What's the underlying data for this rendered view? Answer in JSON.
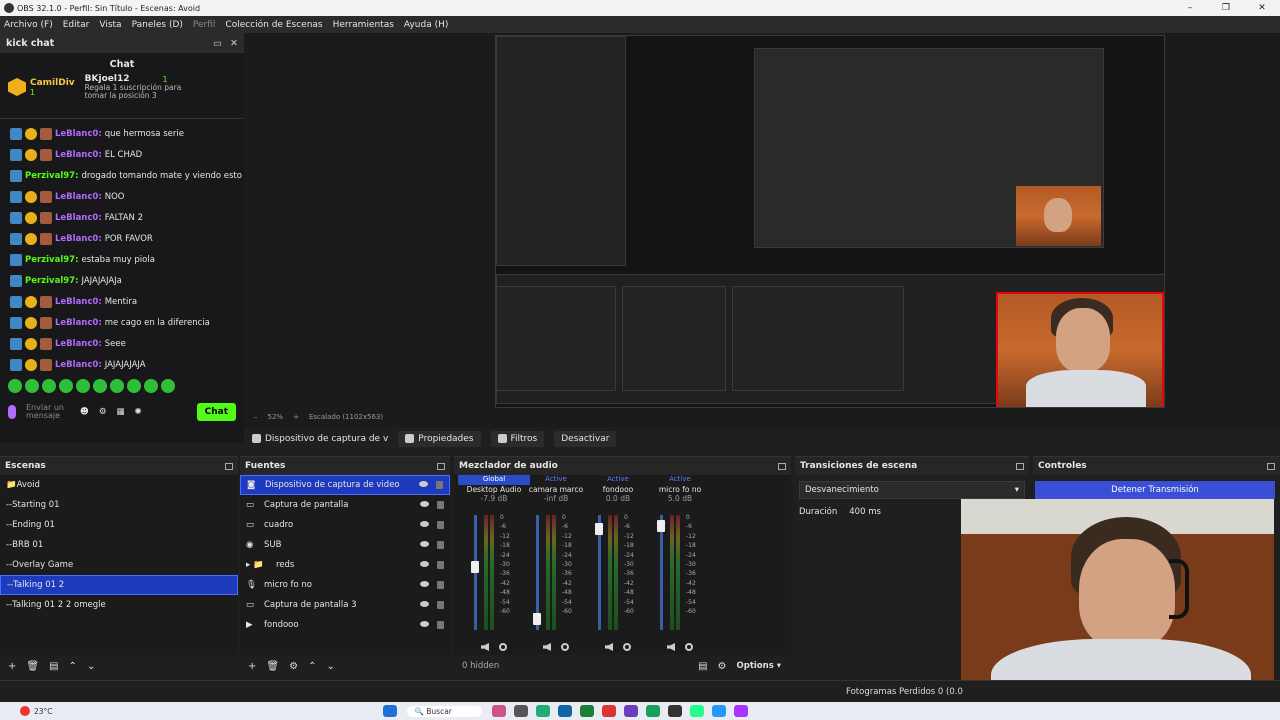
{
  "window": {
    "title": "OBS 32.1.0 - Perfil: Sin Título - Escenas: Avoid"
  },
  "menu": [
    "Archivo (F)",
    "Editar",
    "Vista",
    "Paneles (D)",
    "Perfil",
    "Colección de Escenas",
    "Herramientas",
    "Ayuda (H)"
  ],
  "chat_dock": {
    "title": "kick chat",
    "heading": "Chat",
    "gift": {
      "giver": "CamilDiv",
      "giver_count": "1",
      "recipient": "BKjoel12",
      "recipient_count": "1",
      "text": "Regala 1 suscripción para tomar la posición 3"
    },
    "messages": [
      {
        "user": "LeBlanc0:",
        "text": "que hermosa serie",
        "type": "lb"
      },
      {
        "user": "LeBlanc0:",
        "text": "EL CHAD",
        "type": "lb"
      },
      {
        "user": "Perzival97:",
        "text": "drogado tomando mate y viendo esto",
        "type": "pz"
      },
      {
        "user": "LeBlanc0:",
        "text": "NOO",
        "type": "lb"
      },
      {
        "user": "LeBlanc0:",
        "text": "FALTAN 2",
        "type": "lb"
      },
      {
        "user": "LeBlanc0:",
        "text": "POR FAVOR",
        "type": "lb"
      },
      {
        "user": "Perzival97:",
        "text": "estaba muy piola",
        "type": "pz"
      },
      {
        "user": "Perzival97:",
        "text": "JAJAJAJAJa",
        "type": "pz"
      },
      {
        "user": "LeBlanc0:",
        "text": "Mentira",
        "type": "lb"
      },
      {
        "user": "LeBlanc0:",
        "text": "me cago en la diferencia",
        "type": "lb"
      },
      {
        "user": "LeBlanc0:",
        "text": "Seee",
        "type": "lb"
      },
      {
        "user": "LeBlanc0:",
        "text": "JAJAJAJAJA",
        "type": "lb"
      }
    ],
    "input_placeholder": "Enviar un mensaje",
    "send_label": "Chat"
  },
  "preview": {
    "zoom": "52%",
    "scaled": "Escalado (1102x563)"
  },
  "source_toolbar": {
    "source": "Dispositivo de captura de v",
    "properties": "Propiedades",
    "filters": "Filtros",
    "deactivate": "Desactivar"
  },
  "scenes": {
    "title": "Escenas",
    "items": [
      "Avoid",
      "Starting 01",
      "Ending 01",
      "BRB 01",
      "Overlay Game",
      "Talking 01 2",
      "Talking 01 2 2 omegle"
    ],
    "selected_index": 5
  },
  "sources": {
    "title": "Fuentes",
    "items": [
      "Dispositivo de captura de video",
      "Captura de pantalla",
      "cuadro",
      "SUB",
      "reds",
      "micro fo no",
      "Captura de pantalla 3",
      "fondooo"
    ],
    "selected_index": 0
  },
  "mixer": {
    "title": "Mezclador de audio",
    "hidden": "0 hidden",
    "options": "Options",
    "channels": [
      {
        "status": "Global",
        "name": "Desktop Audio",
        "db": "-7.9 dB",
        "level": 0.55
      },
      {
        "status": "Active",
        "name": "camara marco",
        "db": "-inf dB",
        "level": 0.05
      },
      {
        "status": "Active",
        "name": "fondooo",
        "db": "0.0 dB",
        "level": 0.92
      },
      {
        "status": "Active",
        "name": "micro fo no",
        "db": "5.0 dB",
        "level": 0.95
      }
    ],
    "ticks": [
      "0",
      "-6",
      "-12",
      "-18",
      "-24",
      "-30",
      "-36",
      "-42",
      "-48",
      "-54",
      "-60"
    ]
  },
  "transitions": {
    "title": "Transiciones de escena",
    "selected": "Desvanecimiento",
    "duration_label": "Duración",
    "duration_value": "400 ms"
  },
  "controls": {
    "title": "Controles",
    "stop_stream": "Detener Transmisión"
  },
  "status": {
    "dropped_frames": "Fotogramas Perdidos 0 (0.0"
  },
  "taskbar": {
    "weather": "23°C",
    "search": "Buscar"
  },
  "colors": {
    "kick_green": "#53fc18",
    "selection_blue": "#1f3bbd",
    "stream_button": "#3b4fd6"
  }
}
